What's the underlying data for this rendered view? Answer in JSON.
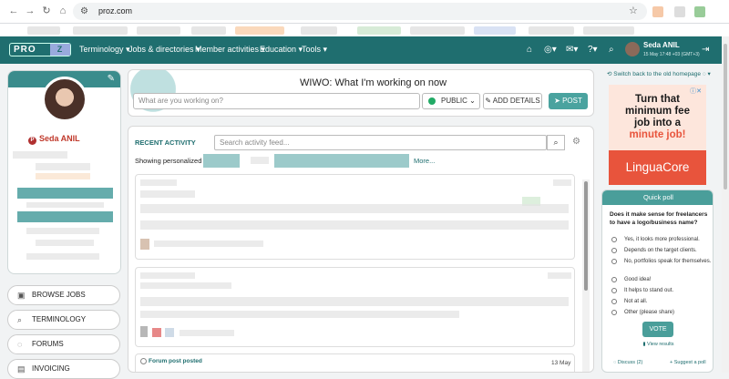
{
  "browser": {
    "url": "proz.com",
    "back_icon": "arrow-left-icon",
    "forward_icon": "arrow-right-icon",
    "reload_icon": "reload-icon",
    "home_icon": "home-icon",
    "star_icon": "star-icon"
  },
  "topnav": {
    "logo": "PRO",
    "logo_z": "Z",
    "menus": [
      "Terminology ▾",
      "Jobs & directories ▾",
      "Member activities ▾",
      "Education ▾",
      "Tools ▾"
    ],
    "user_name": "Seda ANIL",
    "user_time": "15 May 17:48 +03 (GMT+3)",
    "colors": {
      "bar": "#1f6e6f",
      "accent": "#4aa39f"
    }
  },
  "profile": {
    "name": "Seda ANIL",
    "pro_badge": "P"
  },
  "side_buttons": [
    {
      "label": "BROWSE JOBS",
      "icon": "briefcase-icon"
    },
    {
      "label": "TERMINOLOGY",
      "icon": "search-icon"
    },
    {
      "label": "FORUMS",
      "icon": "chat-bubble-icon"
    },
    {
      "label": "INVOICING",
      "icon": "invoice-icon"
    }
  ],
  "wiwo": {
    "title": "WIWO: What I'm working on now",
    "placeholder": "What are you working on?",
    "visibility": "PUBLIC",
    "add_details": "ADD DETAILS",
    "post": "POST"
  },
  "activity": {
    "title": "RECENT ACTIVITY",
    "search_placeholder": "Search activity feed...",
    "showing": "Showing personalized",
    "more": "More...",
    "forum_post_label": "Forum post posted",
    "forum_post_date": "13 May"
  },
  "right": {
    "switch_link": "Switch back to the old homepage",
    "ad": {
      "line1": "Turn that",
      "line2": "minimum fee",
      "line3": "job into a",
      "line4": "minute job!",
      "brand": "LinguaCore"
    }
  },
  "poll": {
    "title": "Quick poll",
    "question": "Does it make sense for freelancers to have a logo/business name?",
    "options": [
      "Yes, it looks more professional.",
      "Depends on the target clients.",
      "No, portfolios speak for themselves.",
      "Good idea!",
      "It helps to stand out.",
      "Not at all.",
      "Other (please share)"
    ],
    "vote": "VOTE",
    "results": "View results",
    "discuss": "Discuss (2)",
    "suggest": "Suggest a poll"
  }
}
